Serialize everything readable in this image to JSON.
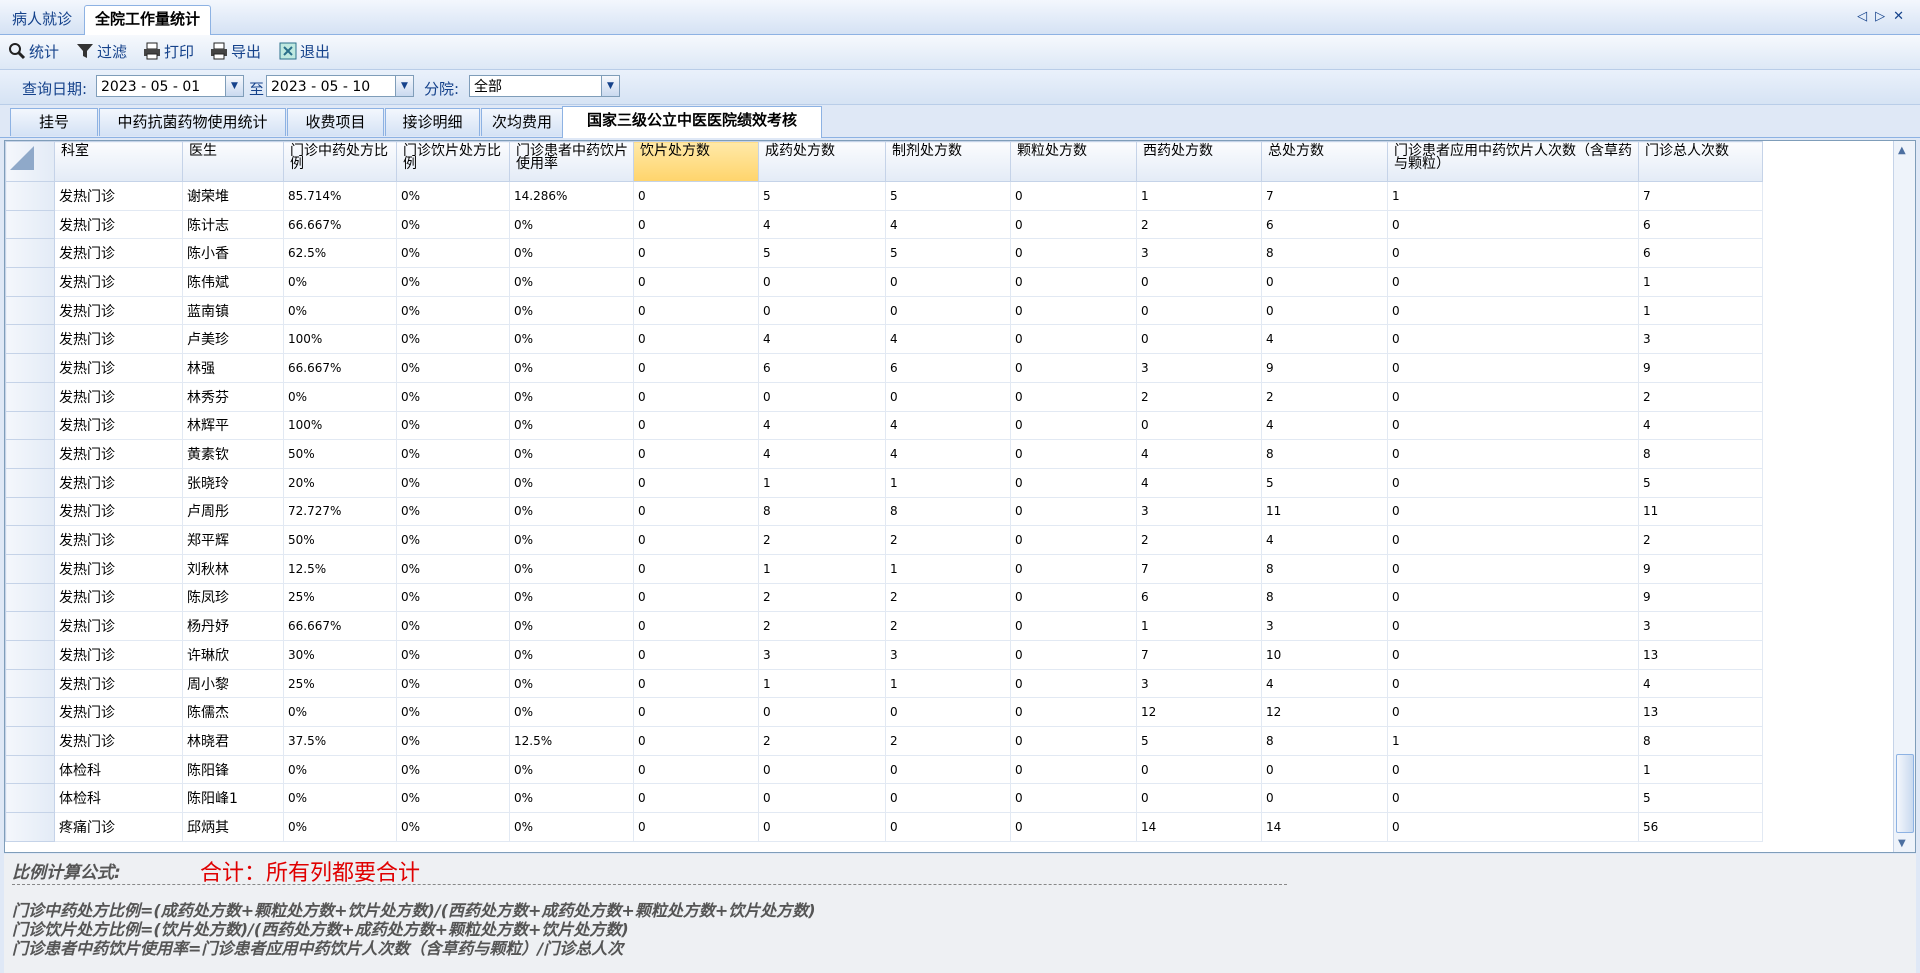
{
  "doc_tabs": [
    "病人就诊",
    "全院工作量统计"
  ],
  "toolbar": [
    {
      "label": "统计",
      "icon": "search-icon"
    },
    {
      "label": "过滤",
      "icon": "filter-icon"
    },
    {
      "label": "打印",
      "icon": "printer-icon"
    },
    {
      "label": "导出",
      "icon": "export-icon"
    },
    {
      "label": "退出",
      "icon": "exit-icon"
    }
  ],
  "query": {
    "date_label": "查询日期:",
    "date_from": "2023 - 05 - 01",
    "to_label": "至",
    "date_to": "2023 - 05 - 10",
    "branch_label": "分院:",
    "branch_value": "全部"
  },
  "subtabs": [
    "挂号",
    "中药抗菌药物使用统计",
    "收费项目",
    "接诊明细",
    "次均费用",
    "国家三级公立中医医院绩效考核"
  ],
  "active_subtab": 5,
  "table": {
    "headers": [
      "科室",
      "医生",
      "门诊中药处方比例",
      "门诊饮片处方比例",
      "门诊患者中药饮片使用率",
      "饮片处方数",
      "成药处方数",
      "制剂处方数",
      "颗粒处方数",
      "西药处方数",
      "总处方数",
      "门诊患者应用中药饮片人次数（含草药与颗粒）",
      "门诊总人次数"
    ],
    "sorted_column": 5,
    "rows": [
      [
        "发热门诊",
        "谢荣堆",
        "85.714%",
        "0%",
        "14.286%",
        "0",
        "5",
        "5",
        "0",
        "1",
        "7",
        "1",
        "7"
      ],
      [
        "发热门诊",
        "陈计志",
        "66.667%",
        "0%",
        "0%",
        "0",
        "4",
        "4",
        "0",
        "2",
        "6",
        "0",
        "6"
      ],
      [
        "发热门诊",
        "陈小香",
        "62.5%",
        "0%",
        "0%",
        "0",
        "5",
        "5",
        "0",
        "3",
        "8",
        "0",
        "6"
      ],
      [
        "发热门诊",
        "陈伟斌",
        "0%",
        "0%",
        "0%",
        "0",
        "0",
        "0",
        "0",
        "0",
        "0",
        "0",
        "1"
      ],
      [
        "发热门诊",
        "蓝南镇",
        "0%",
        "0%",
        "0%",
        "0",
        "0",
        "0",
        "0",
        "0",
        "0",
        "0",
        "1"
      ],
      [
        "发热门诊",
        "卢美珍",
        "100%",
        "0%",
        "0%",
        "0",
        "4",
        "4",
        "0",
        "0",
        "4",
        "0",
        "3"
      ],
      [
        "发热门诊",
        "林强",
        "66.667%",
        "0%",
        "0%",
        "0",
        "6",
        "6",
        "0",
        "3",
        "9",
        "0",
        "9"
      ],
      [
        "发热门诊",
        "林秀芬",
        "0%",
        "0%",
        "0%",
        "0",
        "0",
        "0",
        "0",
        "2",
        "2",
        "0",
        "2"
      ],
      [
        "发热门诊",
        "林辉平",
        "100%",
        "0%",
        "0%",
        "0",
        "4",
        "4",
        "0",
        "0",
        "4",
        "0",
        "4"
      ],
      [
        "发热门诊",
        "黄素钦",
        "50%",
        "0%",
        "0%",
        "0",
        "4",
        "4",
        "0",
        "4",
        "8",
        "0",
        "8"
      ],
      [
        "发热门诊",
        "张晓玲",
        "20%",
        "0%",
        "0%",
        "0",
        "1",
        "1",
        "0",
        "4",
        "5",
        "0",
        "5"
      ],
      [
        "发热门诊",
        "卢周彤",
        "72.727%",
        "0%",
        "0%",
        "0",
        "8",
        "8",
        "0",
        "3",
        "11",
        "0",
        "11"
      ],
      [
        "发热门诊",
        "郑平辉",
        "50%",
        "0%",
        "0%",
        "0",
        "2",
        "2",
        "0",
        "2",
        "4",
        "0",
        "2"
      ],
      [
        "发热门诊",
        "刘秋林",
        "12.5%",
        "0%",
        "0%",
        "0",
        "1",
        "1",
        "0",
        "7",
        "8",
        "0",
        "9"
      ],
      [
        "发热门诊",
        "陈凤珍",
        "25%",
        "0%",
        "0%",
        "0",
        "2",
        "2",
        "0",
        "6",
        "8",
        "0",
        "9"
      ],
      [
        "发热门诊",
        "杨丹妤",
        "66.667%",
        "0%",
        "0%",
        "0",
        "2",
        "2",
        "0",
        "1",
        "3",
        "0",
        "3"
      ],
      [
        "发热门诊",
        "许琳欣",
        "30%",
        "0%",
        "0%",
        "0",
        "3",
        "3",
        "0",
        "7",
        "10",
        "0",
        "13"
      ],
      [
        "发热门诊",
        "周小黎",
        "25%",
        "0%",
        "0%",
        "0",
        "1",
        "1",
        "0",
        "3",
        "4",
        "0",
        "4"
      ],
      [
        "发热门诊",
        "陈儒杰",
        "0%",
        "0%",
        "0%",
        "0",
        "0",
        "0",
        "0",
        "12",
        "12",
        "0",
        "13"
      ],
      [
        "发热门诊",
        "林晓君",
        "37.5%",
        "0%",
        "12.5%",
        "0",
        "2",
        "2",
        "0",
        "5",
        "8",
        "1",
        "8"
      ],
      [
        "体检科",
        "陈阳锋",
        "0%",
        "0%",
        "0%",
        "0",
        "0",
        "0",
        "0",
        "0",
        "0",
        "0",
        "1"
      ],
      [
        "体检科",
        "陈阳峰1",
        "0%",
        "0%",
        "0%",
        "0",
        "0",
        "0",
        "0",
        "0",
        "0",
        "0",
        "5"
      ],
      [
        "疼痛门诊",
        "邱炳其",
        "0%",
        "0%",
        "0%",
        "0",
        "0",
        "0",
        "0",
        "14",
        "14",
        "0",
        "56"
      ]
    ]
  },
  "formula": {
    "title": "比例计算公式:",
    "note": "合计：所有列都要合计",
    "lines": [
      "门诊中药处方比例=(成药处方数+颗粒处方数+饮片处方数)/(西药处方数+成药处方数+颗粒处方数+饮片处方数)",
      "门诊饮片处方比例=(饮片处方数)/(西药处方数+成药处方数+颗粒处方数+饮片处方数)",
      "门诊患者中药饮片使用率=门诊患者应用中药饮片人次数（含草药与颗粒）/门诊总人次"
    ]
  },
  "colors": {
    "accent": "#15428b",
    "sorted_header": "#ffd46b",
    "note": "#e00000"
  }
}
